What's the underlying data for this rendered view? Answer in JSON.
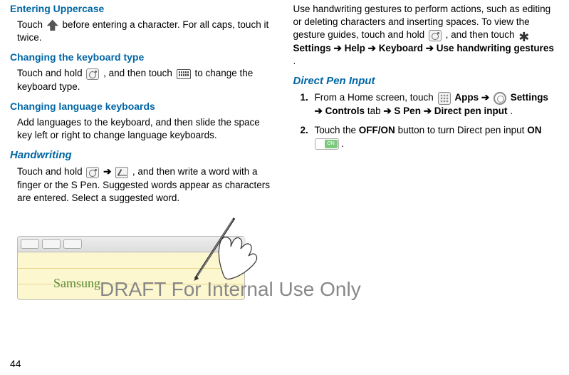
{
  "left": {
    "h1": "Entering Uppercase",
    "p1a": "Touch ",
    "p1b": " before entering a character. For all caps, touch it twice.",
    "h2": "Changing the keyboard type",
    "p2a": "Touch and hold ",
    "p2b": ", and then touch ",
    "p2c": " to change the keyboard type.",
    "h3": "Changing language keyboards",
    "p3": "Add languages to the keyboard, and then slide the space key left or right to change language keyboards.",
    "h4": "Handwriting",
    "p4a": "Touch and hold ",
    "p4b": " ➔ ",
    "p4c": ", and then write a word with a finger or the S Pen. Suggested words appear as characters are entered. Select a suggested word."
  },
  "right": {
    "p1a": "Use handwriting gestures to perform actions, such as editing or deleting characters and inserting spaces. To view the gesture guides, touch and hold ",
    "p1b": ", and then touch ",
    "p1_settings": "Settings",
    "p1_arrow1": " ➔ ",
    "p1_help": "Help",
    "p1_arrow2": " ➔ ",
    "p1_keyboard": "Keyboard",
    "p1_arrow3": " ➔ ",
    "p1_use": "Use handwriting gestures",
    "p1_period": ".",
    "h1": "Direct Pen Input",
    "li1_num": "1.",
    "li1a": "From a Home screen, touch ",
    "li1_apps": "Apps",
    "li1_arrow1": " ➔ ",
    "li1_settings": "Settings",
    "li1_arrow2": " ➔ ",
    "li1_controls": "Controls",
    "li1_tab": " tab ",
    "li1_arrow3": "➔ ",
    "li1_spen": "S Pen",
    "li1_arrow4": " ➔ ",
    "li1_dpi": "Direct pen input",
    "li1_period": ".",
    "li2_num": "2.",
    "li2a": "Touch the ",
    "li2_off": "OFF/ON",
    "li2b": " button to turn Direct pen input ",
    "li2_on": "ON",
    "li2_period": " ."
  },
  "watermark": "DRAFT For Internal Use Only",
  "pagenum": "44",
  "hw_sample": "Samsung"
}
